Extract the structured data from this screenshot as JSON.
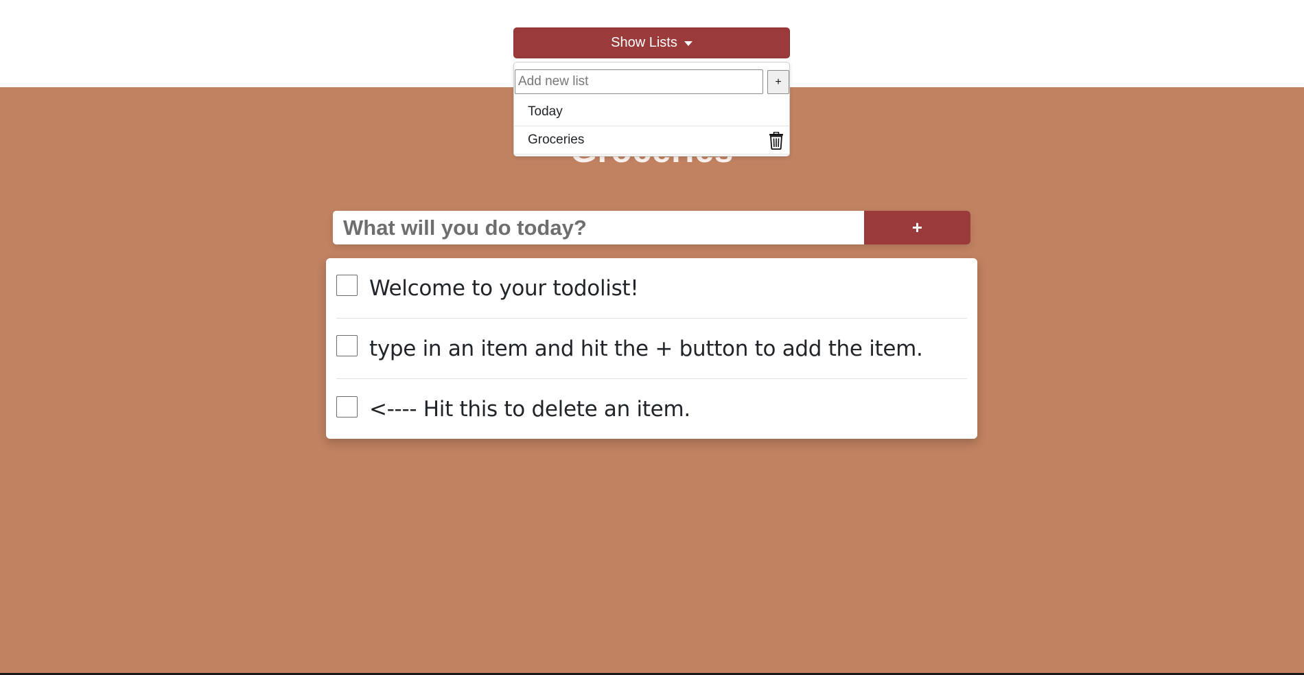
{
  "header": {
    "show_lists_label": "Show Lists"
  },
  "dropdown": {
    "new_list_placeholder": "Add new list",
    "add_label": "+",
    "lists": [
      {
        "label": "Today"
      },
      {
        "label": "Groceries"
      }
    ]
  },
  "list_title": "Groceries",
  "todo_form": {
    "placeholder": "What will you do today?",
    "add_label": "+"
  },
  "items": [
    {
      "text": "Welcome to your todolist!",
      "checked": false
    },
    {
      "text": "type in an item and hit the + button to add the item.",
      "checked": false
    },
    {
      "text": "<---- Hit this to delete an item.",
      "checked": false
    }
  ],
  "colors": {
    "page_background": "#c08261",
    "accent": "#9b3a3a",
    "card": "#ffffff"
  },
  "icons": {
    "delete_list": "trash-icon",
    "dropdown_toggle": "caret-down-icon"
  }
}
